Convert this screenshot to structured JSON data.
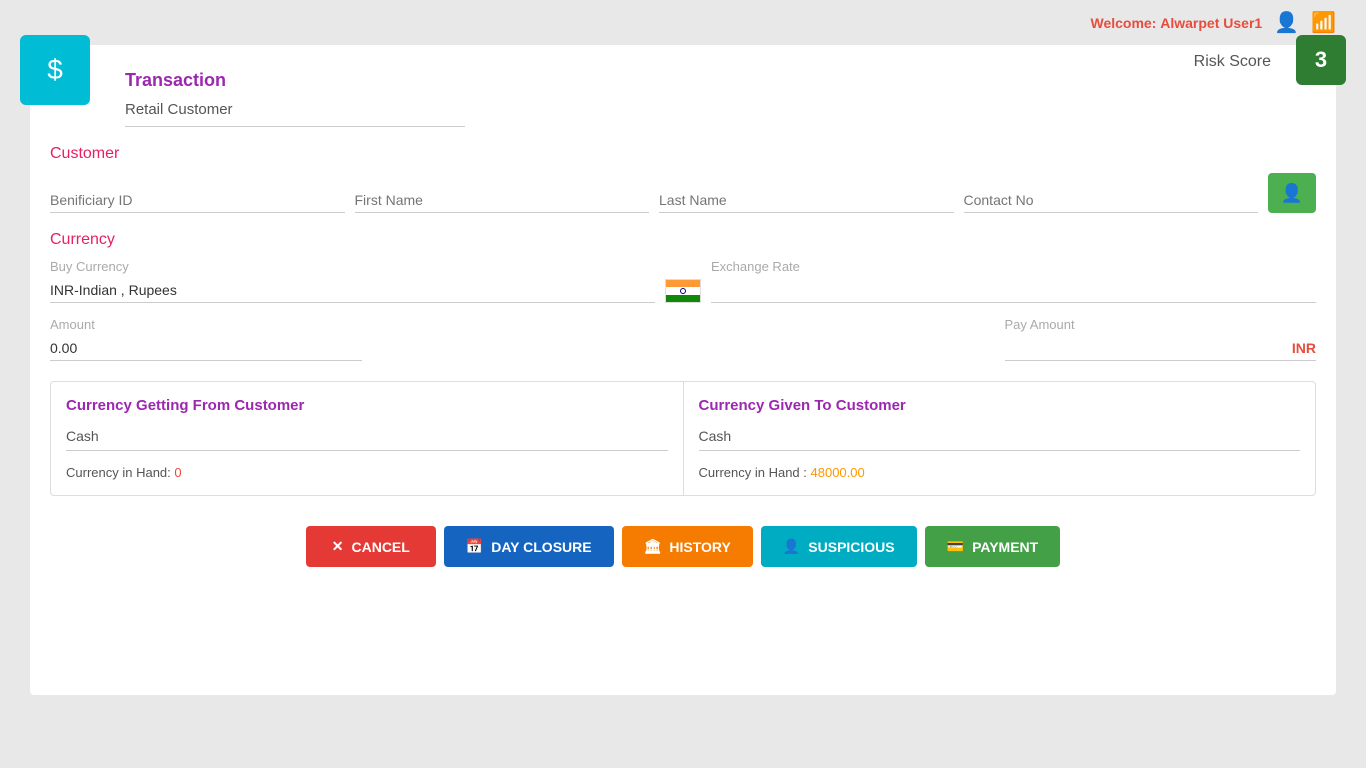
{
  "topBar": {
    "welcomeLabel": "Welcome:",
    "userName": "Alwarpet User1"
  },
  "riskScore": {
    "label": "Risk Score",
    "value": "3"
  },
  "transaction": {
    "title": "Transaction",
    "customerType": "Retail Customer"
  },
  "customer": {
    "sectionTitle": "Customer",
    "beneficiaryIdPlaceholder": "Benificiary ID",
    "firstNamePlaceholder": "First Name",
    "lastNamePlaceholder": "Last Name",
    "contactNoPlaceholder": "Contact No"
  },
  "currency": {
    "sectionTitle": "Currency",
    "buyCurrencyLabel": "Buy Currency",
    "buyCurrencyValue": "INR-Indian , Rupees",
    "exchangeRatePlaceholder": "Exchange Rate",
    "amountLabel": "Amount",
    "amountValue": "0.00",
    "payAmountLabel": "Pay Amount",
    "payAmountCurrency": "INR"
  },
  "panels": {
    "left": {
      "title": "Currency Getting From Customer",
      "field": "Cash",
      "currencyInHandLabel": "Currency in Hand:",
      "currencyInHandValue": "0",
      "currencyInHandColor": "zero"
    },
    "right": {
      "title": "Currency Given To Customer",
      "field": "Cash",
      "currencyInHandLabel": "Currency in Hand :",
      "currencyInHandValue": "48000.00",
      "currencyInHandColor": "value"
    }
  },
  "buttons": {
    "cancel": "CANCEL",
    "dayClosure": "DAY CLOSURE",
    "history": "HISTORY",
    "suspicious": "SUSPICIOUS",
    "payment": "PAYMENT"
  }
}
